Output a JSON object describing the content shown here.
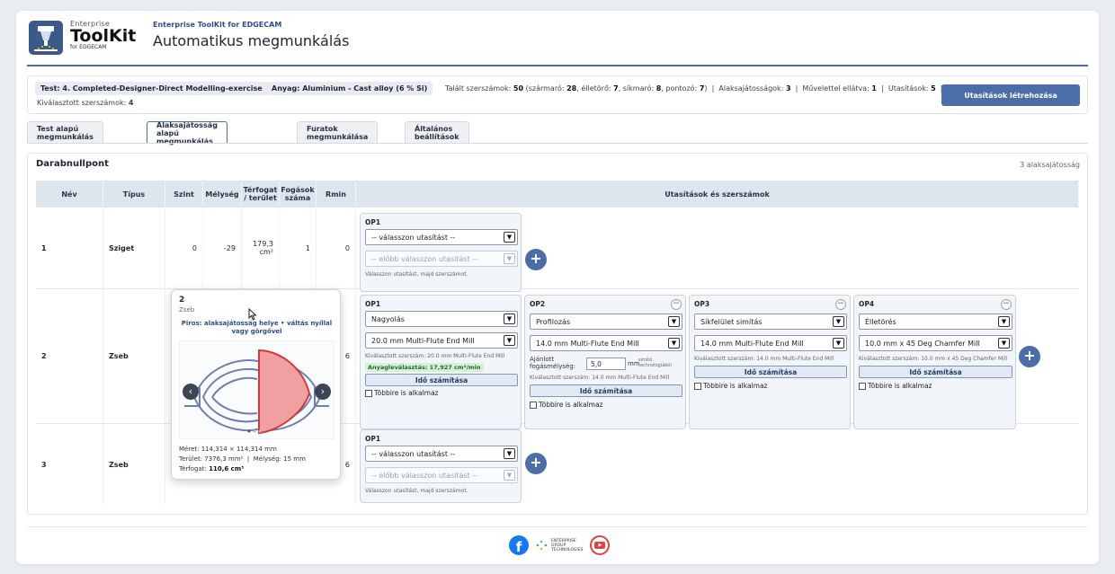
{
  "header": {
    "logo_top": "Enterprise",
    "logo_main": "ToolKit",
    "logo_sub": "for EDGECAM",
    "app_subtitle": "Enterprise ToolKit for EDGECAM",
    "title": "Automatikus megmunkálás"
  },
  "info": {
    "test_label": "Test: 4. Completed-Designer-Direct Modelling-exercise",
    "material_label": "Anyag: Aluminium - Cast alloy (6 % Si)",
    "found_tools_label": "Talált szerszámok:",
    "found_tools": "50",
    "shaft_mill_label": "szármaró:",
    "shaft_mill": "28",
    "chamfer_label": "élletörő:",
    "chamfer": "7",
    "face_mill_label": "síkmaró:",
    "face_mill": "8",
    "drill_label": "pontozó:",
    "drill": "7",
    "features_label": "Alaksajátosságok:",
    "features": "3",
    "with_ops_label": "Művelettel ellátva:",
    "with_ops": "1",
    "instructions_label": "Utasítások:",
    "instructions": "5",
    "selected_tools_label": "Kiválasztott szerszámok:",
    "selected_tools": "4",
    "create_button": "Utasítások létrehozása"
  },
  "tabs": [
    {
      "label": "Test alapú megmunkálás"
    },
    {
      "label": "Alaksajátosság alapú megmunkálás"
    },
    {
      "label": "Furatok megmunkálása"
    },
    {
      "label": "Általános beállítások"
    }
  ],
  "panel": {
    "title": "Darabnullpont",
    "count": "3 alaksajátosság"
  },
  "table": {
    "headers": {
      "name": "Név",
      "type": "Típus",
      "level": "Szint",
      "depth": "Mélység",
      "volume": "Térfogat / terület",
      "passes": "Fogások száma",
      "rmin": "Rmin",
      "instructions": "Utasítások és szerszámok"
    },
    "rows": [
      {
        "name": "1",
        "type": "Sziget",
        "level": "0",
        "depth": "-29",
        "volume": "179,3",
        "volume_unit": "cm²",
        "passes": "1",
        "rmin": "0"
      },
      {
        "name": "2",
        "type": "Zseb",
        "passes": "6"
      },
      {
        "name": "3",
        "type": "Zseb",
        "passes": "6"
      }
    ]
  },
  "ops": {
    "select_instruction": "-- válasszon utasítást --",
    "select_first": "-- előbb válasszon utasítást --",
    "choose_hint": "Válasszon utasítást, majd szerszámot.",
    "time_button": "Idő számítása",
    "apply_more": "Többire is alkalmaz",
    "op1": "OP1",
    "op2": "OP2",
    "op3": "OP3",
    "op4": "OP4",
    "r2_op1_instr": "Nagyolás",
    "r2_op1_tool": "20.0 mm Multi-Flute End Mill",
    "r2_op1_hint": "Kiválasztott szerszám: 20.0 mm Multi-Flute End Mill",
    "r2_op1_mrr": "Anyagleválasztás: 17,927 cm³/min",
    "r2_op2_instr": "Profilozás",
    "r2_op2_tool": "14.0 mm Multi-Flute End Mill",
    "r2_op2_depth_label_1": "Ajánlott",
    "r2_op2_depth_label_2": "fogásmélység:",
    "r2_op2_depth_value": "5,0",
    "r2_op2_unit": "mm",
    "r2_op2_note_1": "simító",
    "r2_op2_note_2": "technológiából",
    "r2_op2_hint": "Kiválasztott szerszám: 14.0 mm Multi-Flute End Mill",
    "r2_op3_instr": "Síkfelület simítás",
    "r2_op3_tool": "14.0 mm Multi-Flute End Mill",
    "r2_op3_hint": "Kiválasztott szerszám: 14.0 mm Multi-Flute End Mill",
    "r2_op4_instr": "Élletörés",
    "r2_op4_tool": "10.0 mm x 45 Deg Chamfer Mill",
    "r2_op4_hint": "Kiválasztott szerszám: 10.0 mm x 45 Deg Chamfer Mill"
  },
  "popup": {
    "num": "2",
    "type": "Zseb",
    "note": "Piros: alaksajátosság helye • váltás nyíllal vagy görgővel",
    "size": "Méret: 114,314 × 114,314 mm",
    "area": "Terület: 7376,3 mm²",
    "depth": "Mélység: 15 mm",
    "volume_label": "Térfogat:",
    "volume": "110,6 cm³"
  },
  "footer": {
    "eg_line1": "ENTERPRISE",
    "eg_line2": "GROUP",
    "eg_line3": "TECHNOLOGIES"
  },
  "colors": {
    "accent": "#4b6ea8",
    "feature_highlight": "#e05555"
  }
}
